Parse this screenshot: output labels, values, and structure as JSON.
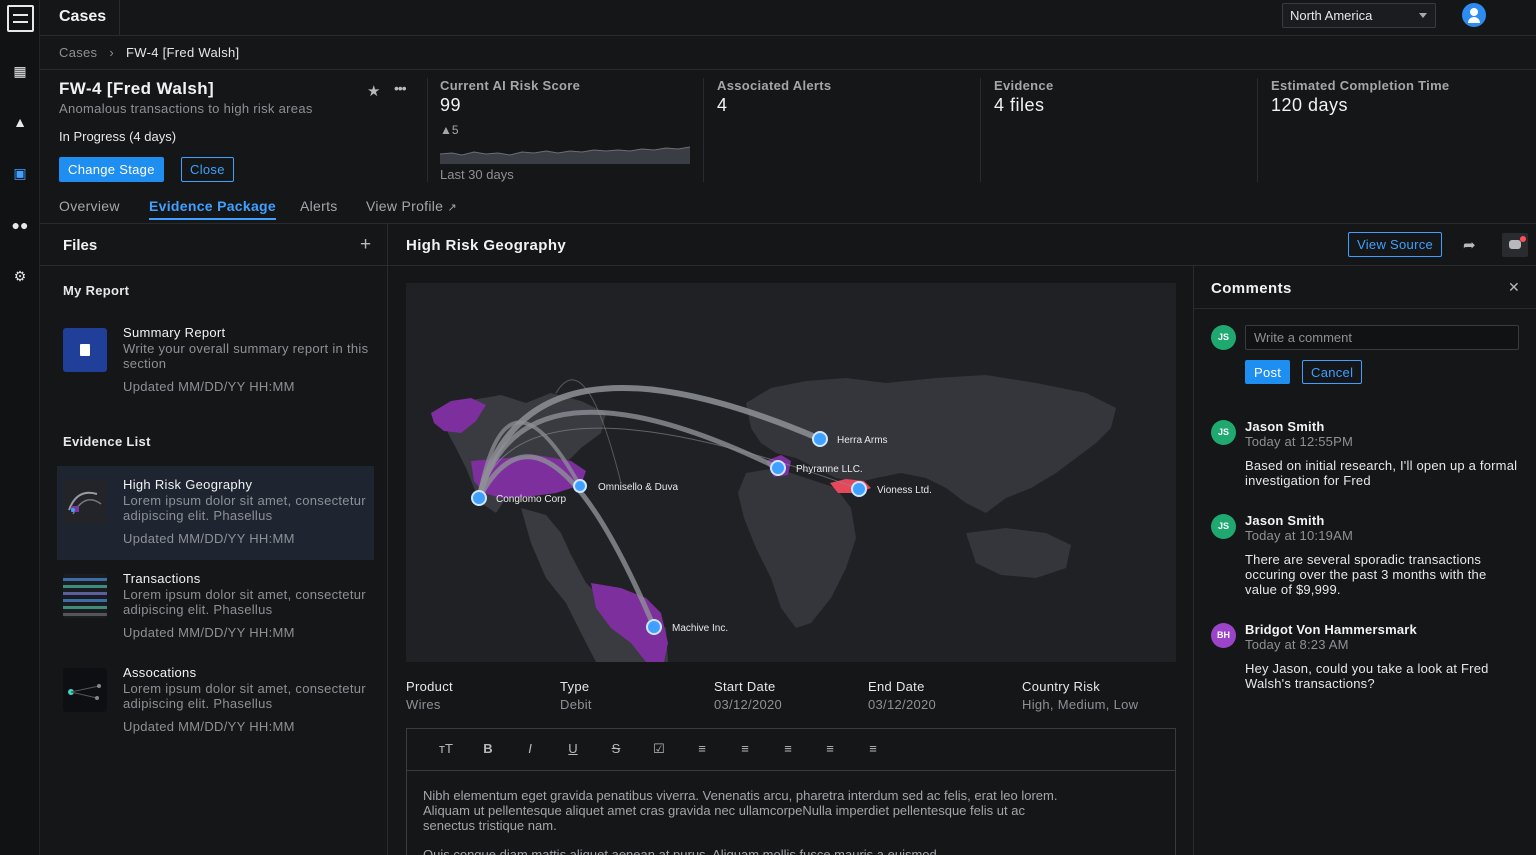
{
  "app": {
    "title": "Cases"
  },
  "region": {
    "selected": "North America"
  },
  "breadcrumb": {
    "root": "Cases",
    "current": "FW-4 [Fred Walsh]"
  },
  "case": {
    "title": "FW-4 [Fred Walsh]",
    "subtitle": "Anomalous transactions to high risk areas",
    "status": "In Progress (4 days)",
    "change_stage_label": "Change Stage",
    "close_label": "Close"
  },
  "metrics": {
    "risk": {
      "label": "Current AI Risk Score",
      "value": "99",
      "delta": "5",
      "period": "Last 30 days"
    },
    "alerts": {
      "label": "Associated Alerts",
      "value": "4"
    },
    "evidence": {
      "label": "Evidence",
      "value": "4 files"
    },
    "completion": {
      "label": "Estimated Completion Time",
      "value": "120 days"
    }
  },
  "tabs": [
    {
      "label": "Overview"
    },
    {
      "label": "Evidence Package"
    },
    {
      "label": "Alerts"
    },
    {
      "label": "View Profile"
    }
  ],
  "files": {
    "title": "Files",
    "my_report_label": "My Report",
    "evidence_list_label": "Evidence List",
    "items": [
      {
        "name": "Summary Report",
        "desc": "Write your overall summary report in this section",
        "updated": "Updated MM/DD/YY HH:MM"
      },
      {
        "name": "High Risk Geography",
        "desc": "Lorem ipsum dolor sit amet, consectetur adipiscing elit. Phasellus",
        "updated": "Updated MM/DD/YY HH:MM"
      },
      {
        "name": "Transactions",
        "desc": "Lorem ipsum dolor sit amet, consectetur adipiscing elit. Phasellus",
        "updated": "Updated MM/DD/YY HH:MM"
      },
      {
        "name": "Assocations",
        "desc": "Lorem ipsum dolor sit amet, consectetur adipiscing elit. Phasellus",
        "updated": "Updated MM/DD/YY HH:MM"
      }
    ]
  },
  "main": {
    "title": "High Risk Geography",
    "view_source_label": "View Source",
    "map_labels": [
      "Conglomo Corp",
      "Omnisello & Duva",
      "Herra Arms",
      "Phyranne LLC.",
      "Vioness Ltd.",
      "Machive Inc."
    ],
    "meta": [
      {
        "key": "Product",
        "value": "Wires"
      },
      {
        "key": "Type",
        "value": "Debit"
      },
      {
        "key": "Start Date",
        "value": "03/12/2020"
      },
      {
        "key": "End Date",
        "value": "03/12/2020"
      },
      {
        "key": "Country Risk",
        "value": "High, Medium, Low"
      }
    ],
    "editor_text_1": "Nibh elementum eget gravida penatibus viverra. Venenatis arcu, pharetra interdum sed ac felis, erat leo lorem. Aliquam ut pellentesque aliquet amet cras gravida nec ullamcorpeNulla imperdiet pellentesque felis ut ac senectus tristique nam.",
    "editor_text_2": "Quis congue diam mattis aliquet aenean at purus. Aliquam mollis fusce mauris a euismod"
  },
  "comments": {
    "title": "Comments",
    "placeholder": "Write a comment",
    "post_label": "Post",
    "cancel_label": "Cancel",
    "items": [
      {
        "initials": "JS",
        "name": "Jason Smith",
        "time": "Today at 12:55PM",
        "body": "Based on initial research, I'll open up a formal investigation for Fred"
      },
      {
        "initials": "JS",
        "name": "Jason Smith",
        "time": "Today at 10:19AM",
        "body": "There are several sporadic transactions occuring over the past 3 months with the value of $9,999."
      },
      {
        "initials": "BH",
        "name": "Bridgot Von Hammersmark",
        "time": "Today at 8:23 AM",
        "body": "Hey Jason, could you take a look at Fred Walsh's transactions?"
      }
    ],
    "my_initials": "JS"
  },
  "colors": {
    "accent": "#1f8ef1",
    "risk_high": "#8a3bab",
    "risk_alert": "#e5485a",
    "avatar_green": "#1fa971",
    "avatar_purple": "#9c44c9"
  },
  "icons": [
    "menu-logo-icon",
    "grid-icon",
    "warning-icon",
    "briefcase-icon",
    "users-icon",
    "gear-icon",
    "star-icon",
    "more-icon",
    "plus-icon",
    "share-icon",
    "chat-icon",
    "close-icon",
    "external-link-icon"
  ]
}
